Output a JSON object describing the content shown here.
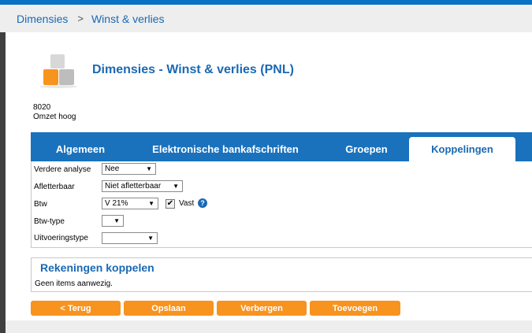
{
  "breadcrumb": {
    "root": "Dimensies",
    "separator": ">",
    "current": "Winst & verlies"
  },
  "header": {
    "title": "Dimensies - Winst & verlies (PNL)",
    "code": "8020",
    "name": "Omzet hoog"
  },
  "tabs": [
    {
      "label": "Algemeen"
    },
    {
      "label": "Elektronische bankafschriften"
    },
    {
      "label": "Groepen"
    },
    {
      "label": "Koppelingen",
      "active": true
    }
  ],
  "form": {
    "verdere_analyse": {
      "label": "Verdere analyse",
      "value": "Nee"
    },
    "afletterbaar": {
      "label": "Afletterbaar",
      "value": "Niet afletterbaar"
    },
    "btw": {
      "label": "Btw",
      "value": "V 21%",
      "vast_label": "Vast",
      "vast_checked": true,
      "help": "?"
    },
    "btw_type": {
      "label": "Btw-type",
      "value": ""
    },
    "uitvoeringstype": {
      "label": "Uitvoeringstype",
      "value": ""
    }
  },
  "panel": {
    "title": "Rekeningen koppelen",
    "empty_text": "Geen items aanwezig."
  },
  "buttons": {
    "terug": "< Terug",
    "opslaan": "Opslaan",
    "verbergen": "Verbergen",
    "toevoegen": "Toevoegen"
  },
  "icons": {
    "dropdown": "▼",
    "check": "✔"
  },
  "colors": {
    "accent": "#1a69b3",
    "tabbar": "#1a72bd",
    "button": "#f7931e",
    "topbar": "#0a72c4"
  }
}
